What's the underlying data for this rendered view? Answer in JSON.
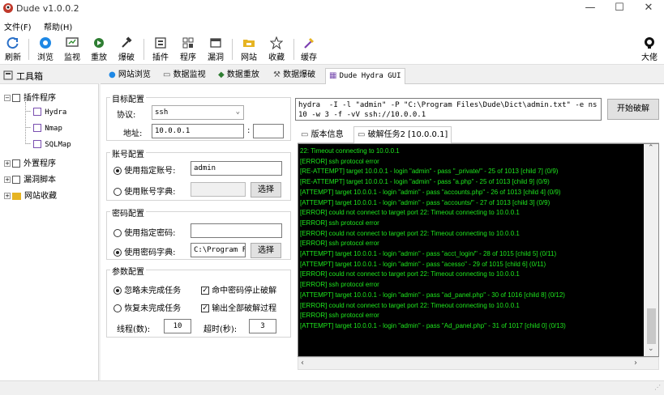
{
  "window": {
    "title": "Dude v1.0.0.2",
    "minimize": "—",
    "maximize": "☐",
    "close": "✕"
  },
  "menu": [
    "文件(F)",
    "帮助(H)"
  ],
  "toolbar": [
    {
      "label": "刷新",
      "icon": "refresh-icon"
    },
    {
      "label": "浏览",
      "icon": "browser-icon"
    },
    {
      "label": "监视",
      "icon": "monitor-icon"
    },
    {
      "label": "重放",
      "icon": "replay-icon"
    },
    {
      "label": "爆破",
      "icon": "hammer-icon"
    },
    {
      "label": "插件",
      "icon": "plugin-icon"
    },
    {
      "label": "程序",
      "icon": "program-icon"
    },
    {
      "label": "漏洞",
      "icon": "vuln-icon"
    },
    {
      "label": "网站",
      "icon": "site-icon"
    },
    {
      "label": "收藏",
      "icon": "star-icon"
    },
    {
      "label": "缓存",
      "icon": "cache-icon"
    },
    {
      "label": "大佬",
      "icon": "github-icon"
    }
  ],
  "left_panel": {
    "title": "工具箱",
    "tree": {
      "plugins": "插件程序",
      "plugin_items": [
        "Hydra",
        "Nmap",
        "SQLMap"
      ],
      "external": "外置程序",
      "scripts": "漏洞脚本",
      "favorites": "网站收藏"
    }
  },
  "tabs": [
    "网站浏览",
    "数据监视",
    "数据重放",
    "数据爆破",
    "Dude Hydra GUI"
  ],
  "target": {
    "group": "目标配置",
    "protocol_label": "协议:",
    "protocol_value": "ssh",
    "address_label": "地址:",
    "address_value": "10.0.0.1",
    "port_sep": ":",
    "port_value": ""
  },
  "account": {
    "group": "账号配置",
    "opt_user": "使用指定账号:",
    "user_value": "admin",
    "opt_dict": "使用账号字典:",
    "dict_value": "",
    "select": "选择"
  },
  "password": {
    "group": "密码配置",
    "opt_pass": "使用指定密码:",
    "pass_value": "",
    "opt_dict": "使用密码字典:",
    "dict_value": "C:\\Program Fi",
    "select": "选择"
  },
  "params": {
    "group": "参数配置",
    "ignore": "忽略未完成任务",
    "restore": "恢复未完成任务",
    "stop_on_hit": "命中密码停止破解",
    "output_all": "输出全部破解过程",
    "threads_label": "线程(数):",
    "threads_value": "10",
    "timeout_label": "超时(秒):",
    "timeout_value": "3"
  },
  "command": "hydra  -I -l \"admin\" -P \"C:\\Program Files\\Dude\\Dict\\admin.txt\" -e ns -t\n10 -w 3 -f -vV ssh://10.0.0.1",
  "start_button": "开始破解",
  "subtabs": [
    "版本信息",
    "破解任务2 [10.0.0.1]"
  ],
  "console_lines": [
    "22: Timeout connecting to 10.0.0.1",
    "[ERROR] ssh protocol error",
    "[RE-ATTEMPT] target 10.0.0.1 - login \"admin\" - pass \"_private/\" - 25 of 1013 [child 7] (0/9)",
    "[RE-ATTEMPT] target 10.0.0.1 - login \"admin\" - pass \"a.php\" - 25 of 1013 [child 9] (0/9)",
    "[ATTEMPT] target 10.0.0.1 - login \"admin\" - pass \"accounts.php\" - 26 of 1013 [child 4] (0/9)",
    "[ATTEMPT] target 10.0.0.1 - login \"admin\" - pass \"accounts/\" - 27 of 1013 [child 3] (0/9)",
    "[ERROR] could not connect to target port 22: Timeout connecting to 10.0.0.1",
    "[ERROR] ssh protocol error",
    "[ERROR] could not connect to target port 22: Timeout connecting to 10.0.0.1",
    "[ERROR] ssh protocol error",
    "[ATTEMPT] target 10.0.0.1 - login \"admin\" - pass \"acct_login/\" - 28 of 1015 [child 5] (0/11)",
    "[ATTEMPT] target 10.0.0.1 - login \"admin\" - pass \"acesso\" - 29 of 1015 [child 6] (0/11)",
    "[ERROR] could not connect to target port 22: Timeout connecting to 10.0.0.1",
    "[ERROR] ssh protocol error",
    "[ATTEMPT] target 10.0.0.1 - login \"admin\" - pass \"ad_panel.php\" - 30 of 1016 [child 8] (0/12)",
    "[ERROR] could not connect to target port 22: Timeout connecting to 10.0.0.1",
    "[ERROR] ssh protocol error",
    "[ATTEMPT] target 10.0.0.1 - login \"admin\" - pass \"Ad_panel.php\" - 31 of 1017 [child 0] (0/13)"
  ]
}
